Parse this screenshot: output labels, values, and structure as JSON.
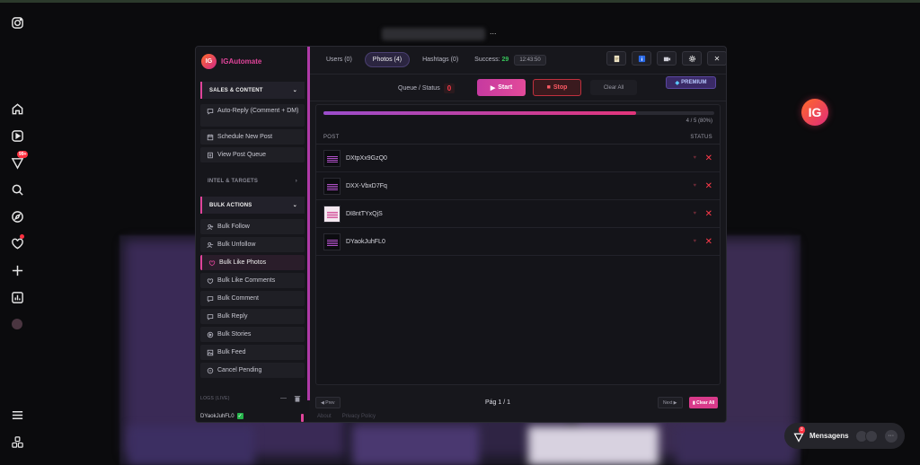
{
  "background": {
    "ellipsis": "..."
  },
  "float_logo": "IG",
  "messages": {
    "label": "Mensagens",
    "badge": "8",
    "more": "···"
  },
  "rail": {
    "notif_badge": "99+"
  },
  "panel": {
    "brand": {
      "logo_text": "IG",
      "name": "IGAutomate"
    },
    "sections": [
      {
        "label": "SALES & CONTENT",
        "chevron": "⌄"
      },
      {
        "label": "INTEL & TARGETS",
        "chevron": "›"
      },
      {
        "label": "BULK ACTIONS",
        "chevron": "⌄"
      }
    ],
    "sales_items": [
      {
        "label": "Auto-Reply (Comment + DM)",
        "icon": "chat-icon"
      },
      {
        "label": "Schedule New Post",
        "icon": "calendar-icon"
      },
      {
        "label": "View Post Queue",
        "icon": "list-icon"
      }
    ],
    "bulk_items": [
      {
        "label": "Bulk Follow",
        "icon": "user-plus-icon"
      },
      {
        "label": "Bulk Unfollow",
        "icon": "user-minus-icon"
      },
      {
        "label": "Bulk Like Photos",
        "icon": "heart-icon",
        "active": true
      },
      {
        "label": "Bulk Like Comments",
        "icon": "heart-icon"
      },
      {
        "label": "Bulk Comment",
        "icon": "chat-icon"
      },
      {
        "label": "Bulk Reply",
        "icon": "reply-icon"
      },
      {
        "label": "Bulk Stories",
        "icon": "story-icon"
      },
      {
        "label": "Bulk Feed",
        "icon": "image-icon"
      },
      {
        "label": "Cancel Pending",
        "icon": "cancel-icon"
      }
    ],
    "logs": {
      "label": "LOGS (LIVE)",
      "minimize": "—",
      "entry": "DYaokJuhFL0",
      "entry_check": "✓"
    },
    "tabs": [
      {
        "label": "Users (0)",
        "active": false
      },
      {
        "label": "Photos (4)",
        "active": true
      },
      {
        "label": "Hashtags (0)",
        "active": false
      }
    ],
    "success": {
      "label": "Success:",
      "value": "29"
    },
    "clock": "12:43:50",
    "tools": {
      "close": "✕"
    },
    "controls": {
      "queue_label": "Queue / Status",
      "queue_count": "0",
      "start": "Start",
      "stop": "Stop",
      "clear": "Clear All",
      "premium": "PREMIUM"
    },
    "progress": {
      "fraction": 0.8,
      "text": "4 / 5 (80%)"
    },
    "table": {
      "headers": {
        "post": "POST",
        "status": "STATUS"
      },
      "rows": [
        {
          "code": "DXtpXx9GzQ0",
          "thumb": "dark"
        },
        {
          "code": "DXX-VbxD7Fq",
          "thumb": "dark"
        },
        {
          "code": "DI8ntTYxQjS",
          "thumb": "light"
        },
        {
          "code": "DYaokJuhFL0",
          "thumb": "dark"
        }
      ]
    },
    "pager": {
      "prev": "◀ Prev",
      "page": "Pág 1 / 1",
      "next": "Next ▶",
      "clear_all": "Clear All"
    },
    "footer": {
      "about": "About",
      "privacy": "Privacy Policy"
    }
  },
  "colors": {
    "accent": "#e0449a",
    "success": "#37c45a",
    "danger": "#ff3a4a",
    "premium": "#3a2a66"
  }
}
